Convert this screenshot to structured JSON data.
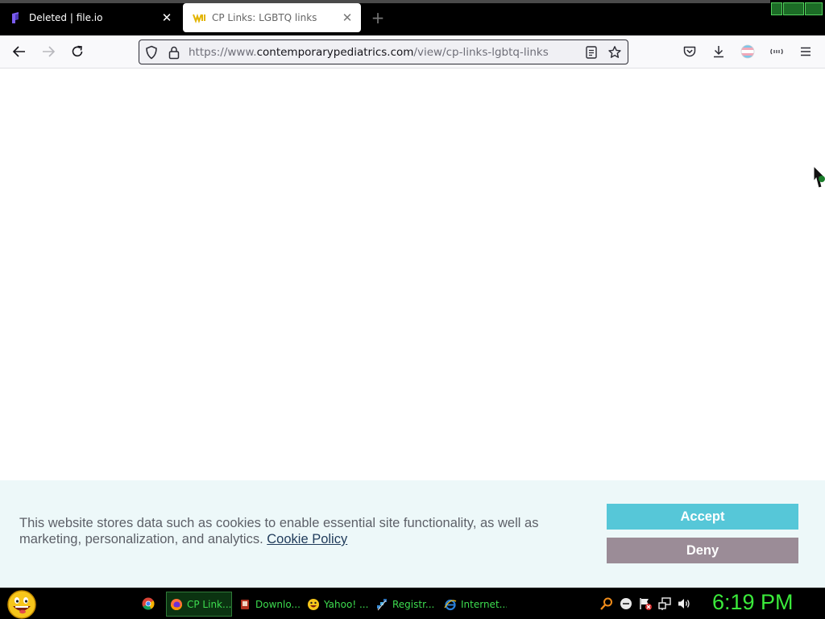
{
  "browser": {
    "tabs": [
      {
        "label": "Deleted | file.io",
        "icon": "file-io-icon",
        "active": false
      },
      {
        "label": "CP Links: LGBTQ links",
        "icon": "contemporary-pediatrics-icon",
        "active": true
      }
    ],
    "url": {
      "prefix": "https://www.",
      "domain": "contemporarypediatrics.com",
      "path": "/view/cp-links-lgbtq-links"
    },
    "toolbar_icons": [
      "back-icon",
      "forward-icon",
      "reload-icon",
      "pocket-icon",
      "download-icon",
      "profile-icon",
      "extension-icon",
      "menu-icon"
    ]
  },
  "cookie_banner": {
    "text": "This website stores data such as cookies to enable essential site functionality, as well as marketing, personalization, and analytics.",
    "link_label": "Cookie Policy",
    "accept_label": "Accept",
    "deny_label": "Deny",
    "accept_color": "#56c7d8",
    "deny_color": "#9b8c97",
    "background": "#edf8f9"
  },
  "taskbar": {
    "tasks": [
      {
        "label": "CP Link...",
        "icon": "firefox-icon",
        "active": true
      },
      {
        "label": "Downlo...",
        "icon": "downloads-icon",
        "active": false
      },
      {
        "label": "Yahoo! ...",
        "icon": "yahoo-messenger-icon",
        "active": false
      },
      {
        "label": "Registr...",
        "icon": "registry-icon",
        "active": false
      },
      {
        "label": "Internet...",
        "icon": "internet-explorer-icon",
        "active": false
      }
    ],
    "clock": "6:19 PM",
    "accent": "#3bea3b"
  }
}
